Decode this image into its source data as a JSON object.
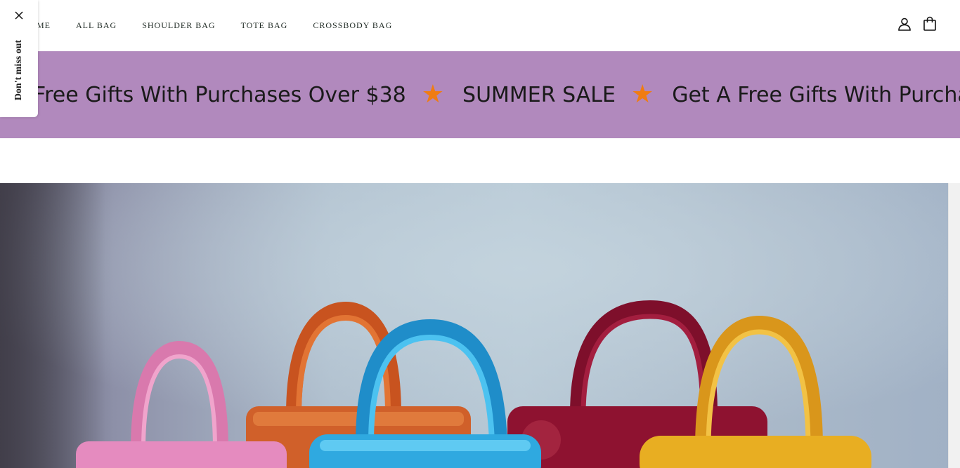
{
  "side_tab": {
    "label": "Don't miss out",
    "close_icon": "close-icon"
  },
  "nav": {
    "items": [
      {
        "label": "ME"
      },
      {
        "label": "ALL BAG"
      },
      {
        "label": "SHOULDER BAG"
      },
      {
        "label": "TOTE BAG"
      },
      {
        "label": "CROSSBODY BAG"
      }
    ]
  },
  "header_icons": {
    "account": "user-icon",
    "cart": "shopping-bag-icon"
  },
  "announcement": {
    "messages": [
      "Free Gifts With Purchases Over $38",
      "SUMMER SALE",
      "Get A Free Gifts With Purchases O"
    ],
    "separator_icon": "star-icon",
    "background": "#b189bd",
    "star_color": "#f07c12"
  },
  "hero": {
    "image": "colorful-handbags-hero-image",
    "bag_colors": [
      "#e58bbf",
      "#d2622a",
      "#2fa9e0",
      "#8e1230",
      "#e8ae22"
    ]
  }
}
